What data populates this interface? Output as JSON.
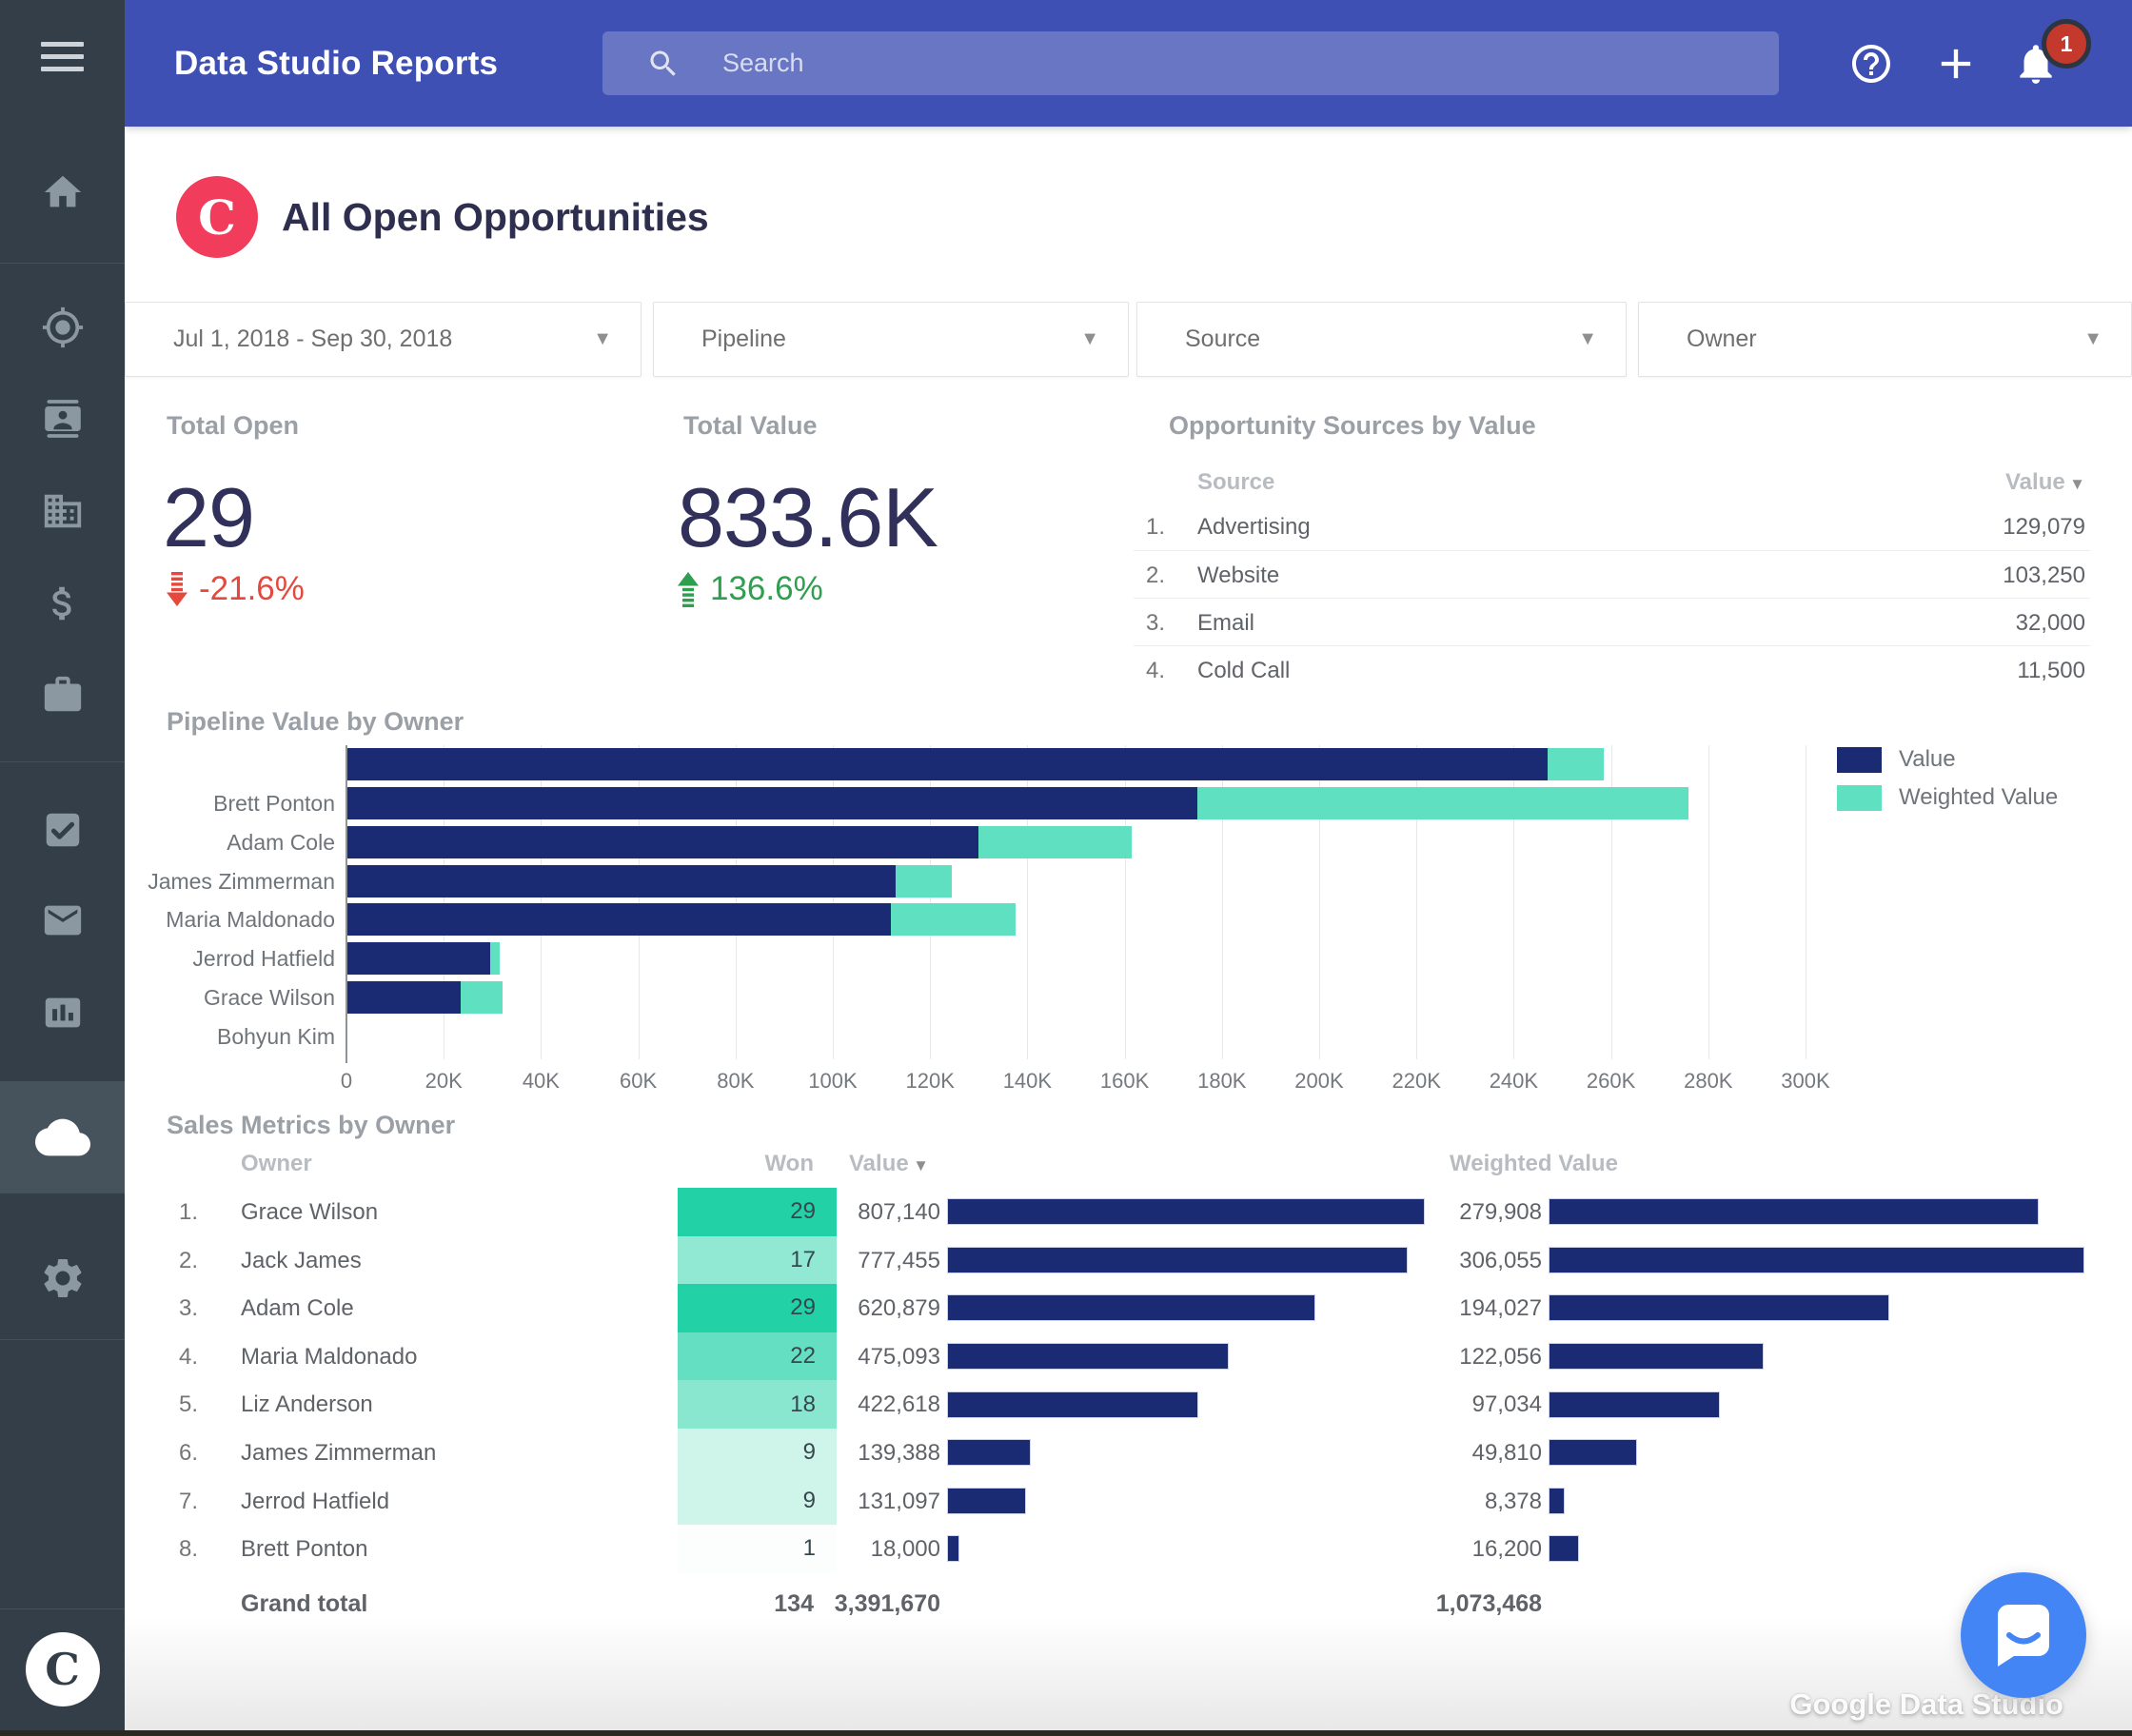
{
  "header": {
    "app_title": "Data Studio Reports",
    "search_placeholder": "Search",
    "notification_count": "1"
  },
  "sidebar": {
    "icons": [
      "menu",
      "home",
      "target",
      "contact-card",
      "building",
      "dollar",
      "briefcase",
      "task-check",
      "envelope",
      "bar-chart",
      "cloud",
      "gear",
      "copper-logo"
    ],
    "active_icon": "cloud",
    "logo_letter": "C"
  },
  "report": {
    "title": "All Open Opportunities",
    "logo_letter": "C"
  },
  "filters": [
    {
      "id": "date-range",
      "label": "Jul 1, 2018 - Sep 30, 2018"
    },
    {
      "id": "pipeline",
      "label": "Pipeline"
    },
    {
      "id": "source",
      "label": "Source"
    },
    {
      "id": "owner",
      "label": "Owner"
    }
  ],
  "scorecards": [
    {
      "label": "Total Open",
      "value": "29",
      "delta": "-21.6%",
      "trend": "down"
    },
    {
      "label": "Total Value",
      "value": "833.6K",
      "delta": "136.6%",
      "trend": "up"
    }
  ],
  "sources_table": {
    "title": "Opportunity Sources by Value",
    "col_source": "Source",
    "col_value": "Value",
    "rows": [
      {
        "rank": "1.",
        "source": "Advertising",
        "value": "129,079"
      },
      {
        "rank": "2.",
        "source": "Website",
        "value": "103,250"
      },
      {
        "rank": "3.",
        "source": "Email",
        "value": "32,000"
      },
      {
        "rank": "4.",
        "source": "Cold Call",
        "value": "11,500"
      }
    ]
  },
  "chart_data": {
    "type": "bar",
    "orientation": "horizontal",
    "stacked": true,
    "title": "Pipeline Value by Owner",
    "categories": [
      "",
      "Brett Ponton",
      "Adam Cole",
      "James Zimmerman",
      "Maria Maldonado",
      "Jerrod Hatfield",
      "Grace Wilson",
      "Bohyun Kim"
    ],
    "series": [
      {
        "name": "Value",
        "color": "#1b2b73",
        "values": [
          247000,
          175000,
          130000,
          113000,
          112000,
          29500,
          23500,
          0
        ]
      },
      {
        "name": "Weighted Value",
        "color": "#5fe1c1",
        "values": [
          11500,
          101000,
          31500,
          11500,
          25500,
          2000,
          8500,
          0
        ]
      }
    ],
    "xlim": [
      0,
      300000
    ],
    "x_ticks": [
      "0",
      "20K",
      "40K",
      "60K",
      "80K",
      "100K",
      "120K",
      "140K",
      "160K",
      "180K",
      "200K",
      "220K",
      "240K",
      "260K",
      "280K",
      "300K"
    ],
    "grid": true,
    "legend_position": "top-right"
  },
  "sales_table": {
    "title": "Sales Metrics by Owner",
    "col_owner": "Owner",
    "col_won": "Won",
    "col_value": "Value",
    "col_weighted": "Weighted Value",
    "rows": [
      {
        "rank": "1.",
        "owner": "Grace Wilson",
        "won": 29,
        "value": 807140,
        "value_label": "807,140",
        "weighted": 279908,
        "weighted_label": "279,908"
      },
      {
        "rank": "2.",
        "owner": "Jack James",
        "won": 17,
        "value": 777455,
        "value_label": "777,455",
        "weighted": 306055,
        "weighted_label": "306,055"
      },
      {
        "rank": "3.",
        "owner": "Adam Cole",
        "won": 29,
        "value": 620879,
        "value_label": "620,879",
        "weighted": 194027,
        "weighted_label": "194,027"
      },
      {
        "rank": "4.",
        "owner": "Maria Maldonado",
        "won": 22,
        "value": 475093,
        "value_label": "475,093",
        "weighted": 122056,
        "weighted_label": "122,056"
      },
      {
        "rank": "5.",
        "owner": "Liz Anderson",
        "won": 18,
        "value": 422618,
        "value_label": "422,618",
        "weighted": 97034,
        "weighted_label": "97,034"
      },
      {
        "rank": "6.",
        "owner": "James Zimmerman",
        "won": 9,
        "value": 139388,
        "value_label": "139,388",
        "weighted": 49810,
        "weighted_label": "49,810"
      },
      {
        "rank": "7.",
        "owner": "Jerrod Hatfield",
        "won": 9,
        "value": 131097,
        "value_label": "131,097",
        "weighted": 8378,
        "weighted_label": "8,378"
      },
      {
        "rank": "8.",
        "owner": "Brett Ponton",
        "won": 1,
        "value": 18000,
        "value_label": "18,000",
        "weighted": 16200,
        "weighted_label": "16,200"
      }
    ],
    "grand_total": {
      "label": "Grand total",
      "won": "134",
      "value": "3,391,670",
      "weighted": "1,073,468"
    }
  },
  "watermark": "Google Data Studio",
  "colors": {
    "header_blue": "#3e50b4",
    "sidebar_dark": "#333e48",
    "navy_bar": "#1b2b73",
    "teal_bar": "#5fe1c1",
    "won_heat_rgb": [
      35,
      209,
      166
    ],
    "scorecard_navy": "#30305a",
    "negative_red": "#e5493d",
    "positive_green": "#2f9e4f",
    "brand_pink": "#f13c5c"
  }
}
